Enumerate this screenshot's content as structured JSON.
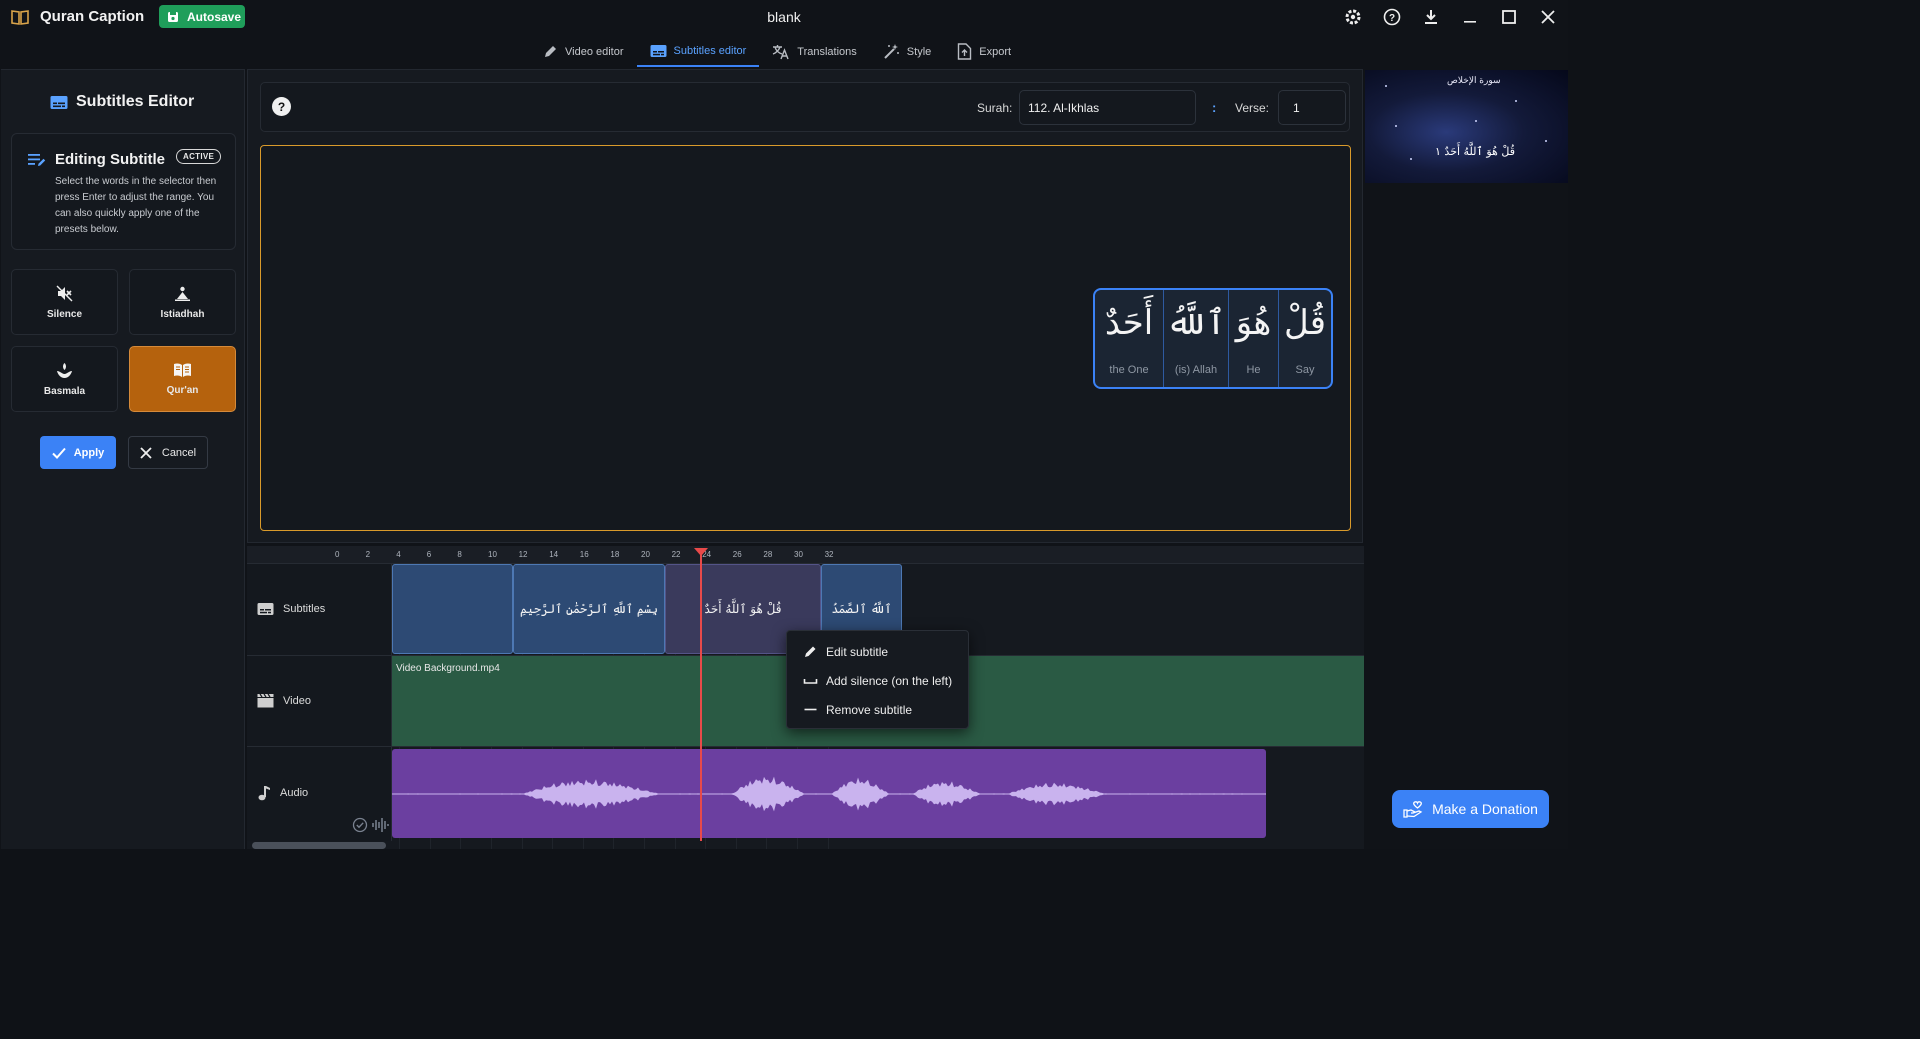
{
  "app": {
    "name": "Quran Caption",
    "autosave_label": "Autosave",
    "window_title": "blank"
  },
  "window_icons": [
    "settings-icon",
    "help-circle-icon",
    "download-icon",
    "minimize-icon",
    "maximize-icon",
    "close-icon"
  ],
  "tabs": [
    {
      "label": "Video editor",
      "icon": "pencil-icon",
      "active": false
    },
    {
      "label": "Subtitles editor",
      "icon": "subtitles-icon",
      "active": true
    },
    {
      "label": "Translations",
      "icon": "translate-icon",
      "active": false
    },
    {
      "label": "Style",
      "icon": "magic-wand-icon",
      "active": false
    },
    {
      "label": "Export",
      "icon": "export-file-icon",
      "active": false
    }
  ],
  "left_panel": {
    "heading": "Subtitles Editor",
    "editing_title": "Editing Subtitle",
    "badge": "ACTIVE",
    "description": "Select the words in the selector then press Enter to adjust the range. You can also quickly apply one of the presets below.",
    "presets": [
      {
        "label": "Silence",
        "icon": "mute-icon",
        "selected": false
      },
      {
        "label": "Istiadhah",
        "icon": "person-prayer-icon",
        "selected": false
      },
      {
        "label": "Basmala",
        "icon": "hand-flower-icon",
        "selected": false
      },
      {
        "label": "Qur'an",
        "icon": "open-book-icon",
        "selected": true
      }
    ],
    "apply_label": "Apply",
    "cancel_label": "Cancel"
  },
  "selector": {
    "surah_label": "Surah:",
    "surah_value": "112. Al-Ikhlas",
    "colon": ":",
    "verse_label": "Verse:",
    "verse_value": "1"
  },
  "words": [
    {
      "arabic": "أَحَدٌ",
      "english": "the One"
    },
    {
      "arabic": "ٱللَّهُ",
      "english": "(is) Allah"
    },
    {
      "arabic": "هُوَ",
      "english": "He"
    },
    {
      "arabic": "قُلْ",
      "english": "Say"
    }
  ],
  "preview": {
    "header_text": "سورة الإخلاص",
    "caption": "قُلْ هُوَ ٱللَّهُ أَحَدٌ ١"
  },
  "timeline": {
    "ticks": [
      "0",
      "2",
      "4",
      "6",
      "8",
      "10",
      "12",
      "14",
      "16",
      "18",
      "20",
      "22",
      "24",
      "26",
      "28",
      "30",
      "32"
    ],
    "tracks": {
      "subtitles": "Subtitles",
      "video": "Video",
      "audio": "Audio"
    },
    "subtitle_clips": [
      {
        "text": "",
        "start": 0,
        "end": 3.9
      },
      {
        "text": "بِسْمِ ٱللَّهِ ٱلرَّحْمَٰنِ ٱلرَّحِيمِ",
        "start": 3.9,
        "end": 8.9
      },
      {
        "text": "قُلْ هُوَ ٱللَّهُ أَحَدٌ",
        "start": 8.9,
        "end": 14.0
      },
      {
        "text": "ٱللَّهُ ٱلصَّمَدُ",
        "start": 14.0,
        "end": 16.7
      }
    ],
    "video_clip_name": "Video Background.mp4",
    "playhead_time": 12,
    "audio_end": 28.5
  },
  "context_menu": [
    {
      "label": "Edit subtitle",
      "icon": "pencil-icon"
    },
    {
      "label": "Add silence (on the left)",
      "icon": "space-bracket-icon"
    },
    {
      "label": "Remove subtitle",
      "icon": "minus-icon"
    }
  ],
  "donate_label": "Make a Donation"
}
